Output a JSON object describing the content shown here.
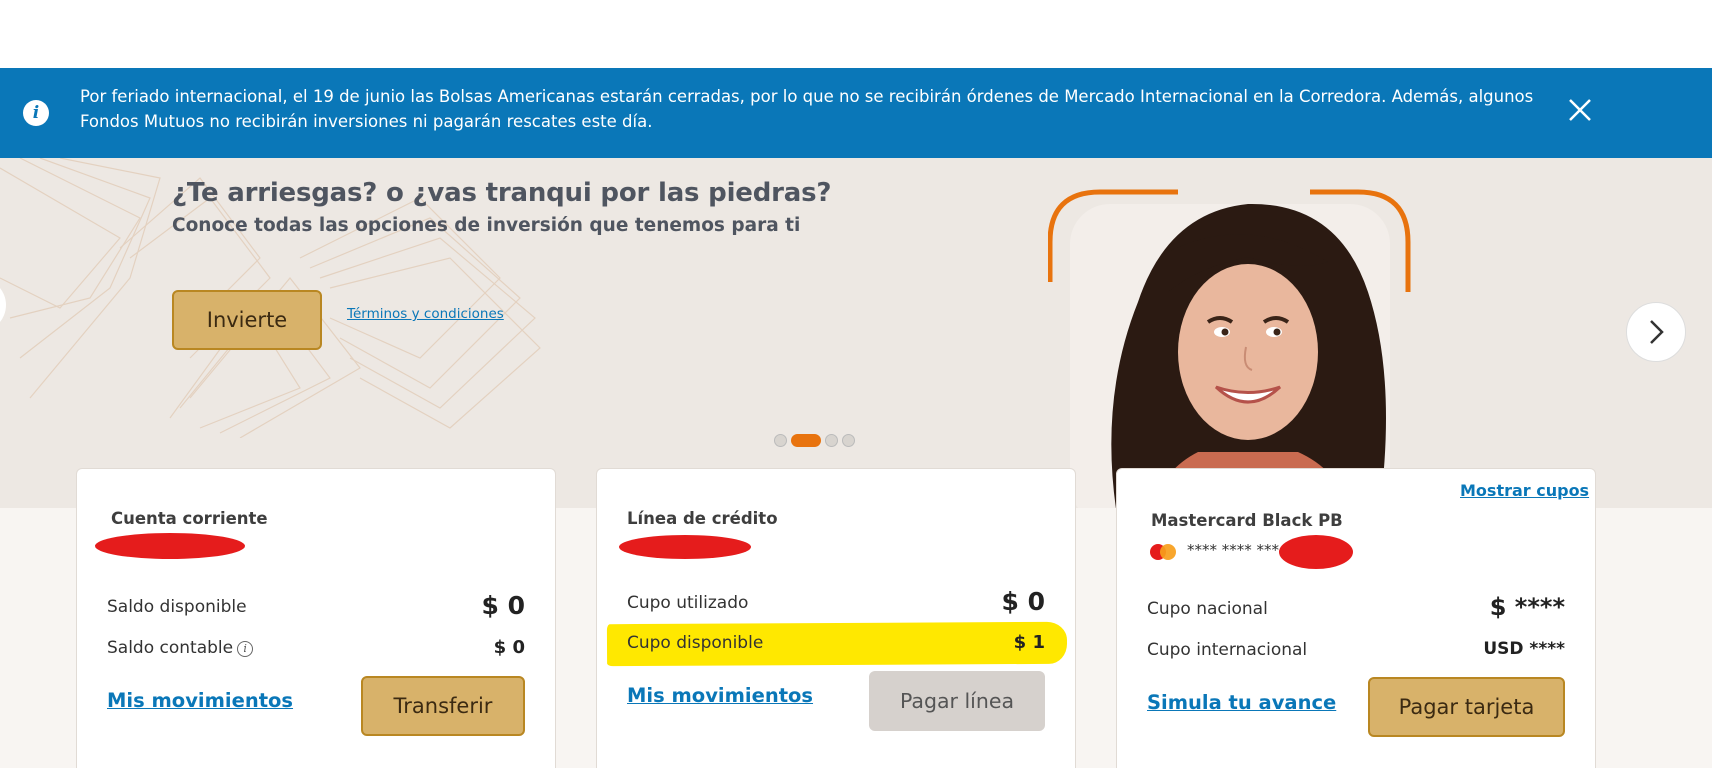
{
  "notice": {
    "message": "Por feriado internacional, el 19 de junio las Bolsas Americanas estarán cerradas, por lo que no se recibirán órdenes de Mercado Internacional en la Corredora. Además, algunos Fondos Mutuos no recibirán inversiones ni pagarán rescates este día.",
    "info_glyph": "i",
    "icon": "close-icon",
    "background": "#0a77b8"
  },
  "hero": {
    "title": "¿Te arriesgas? o ¿vas tranqui por las piedras?",
    "subtitle": "Conoce todas las opciones de inversión que tenemos para ti",
    "cta_label": "Invierte",
    "terms_label": "Términos y condiciones",
    "slide_count": 4,
    "active_slide": 2,
    "accent": "#e8730e"
  },
  "cards": {
    "checking": {
      "title": "Cuenta corriente",
      "rows": [
        {
          "label": "Saldo disponible",
          "value": "$ 0"
        },
        {
          "label": "Saldo contable",
          "value": "$ 0",
          "info_glyph": "i"
        }
      ],
      "link_label": "Mis movimientos",
      "button_label": "Transferir"
    },
    "credit_line": {
      "title": "Línea de crédito",
      "rows": [
        {
          "label": "Cupo utilizado",
          "value": "$ 0"
        },
        {
          "label": "Cupo disponible",
          "value": "$ 1"
        }
      ],
      "link_label": "Mis movimientos",
      "button_label": "Pagar línea"
    },
    "credit_card": {
      "title": "Mastercard Black PB",
      "show_limits_label": "Mostrar cupos",
      "card_number_masked": "**** **** ***",
      "rows": [
        {
          "label": "Cupo nacional",
          "value": "$ ****"
        },
        {
          "label": "Cupo internacional",
          "value": "USD ****"
        }
      ],
      "link_label": "Simula tu avance",
      "button_label": "Pagar tarjeta"
    }
  },
  "colors": {
    "gold_button": "#d8b26a",
    "link_blue": "#0a77b8",
    "redaction": "#e51c1c",
    "highlight": "#ffe800"
  }
}
